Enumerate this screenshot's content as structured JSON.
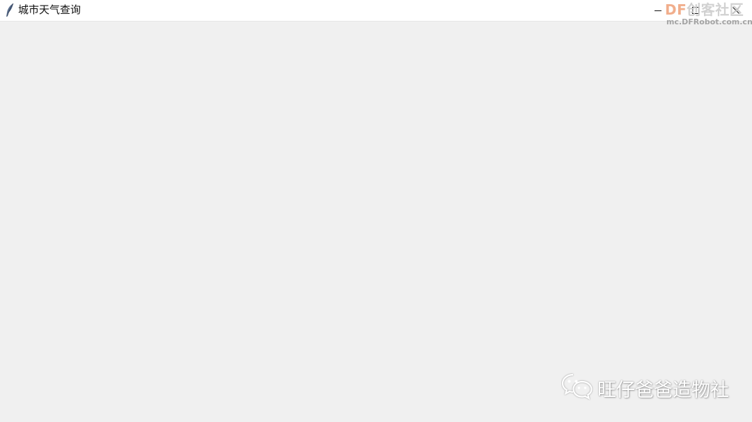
{
  "window": {
    "title": "城市天气查询",
    "app_icon": "feather-icon",
    "controls": {
      "minimize_icon": "minimize-icon",
      "maximize_icon": "maximize-icon",
      "close_icon": "close-icon"
    }
  },
  "watermarks": {
    "brand_prefix": "DF",
    "brand_name": "创客社区",
    "brand_url": "mc.DFRobot.com.cn",
    "wechat_icon": "wechat-icon",
    "wechat_account": "旺仔爸爸造物社"
  },
  "colors": {
    "titlebar_bg": "#ffffff",
    "client_bg": "#f0f0f0",
    "title_text": "#111111"
  }
}
